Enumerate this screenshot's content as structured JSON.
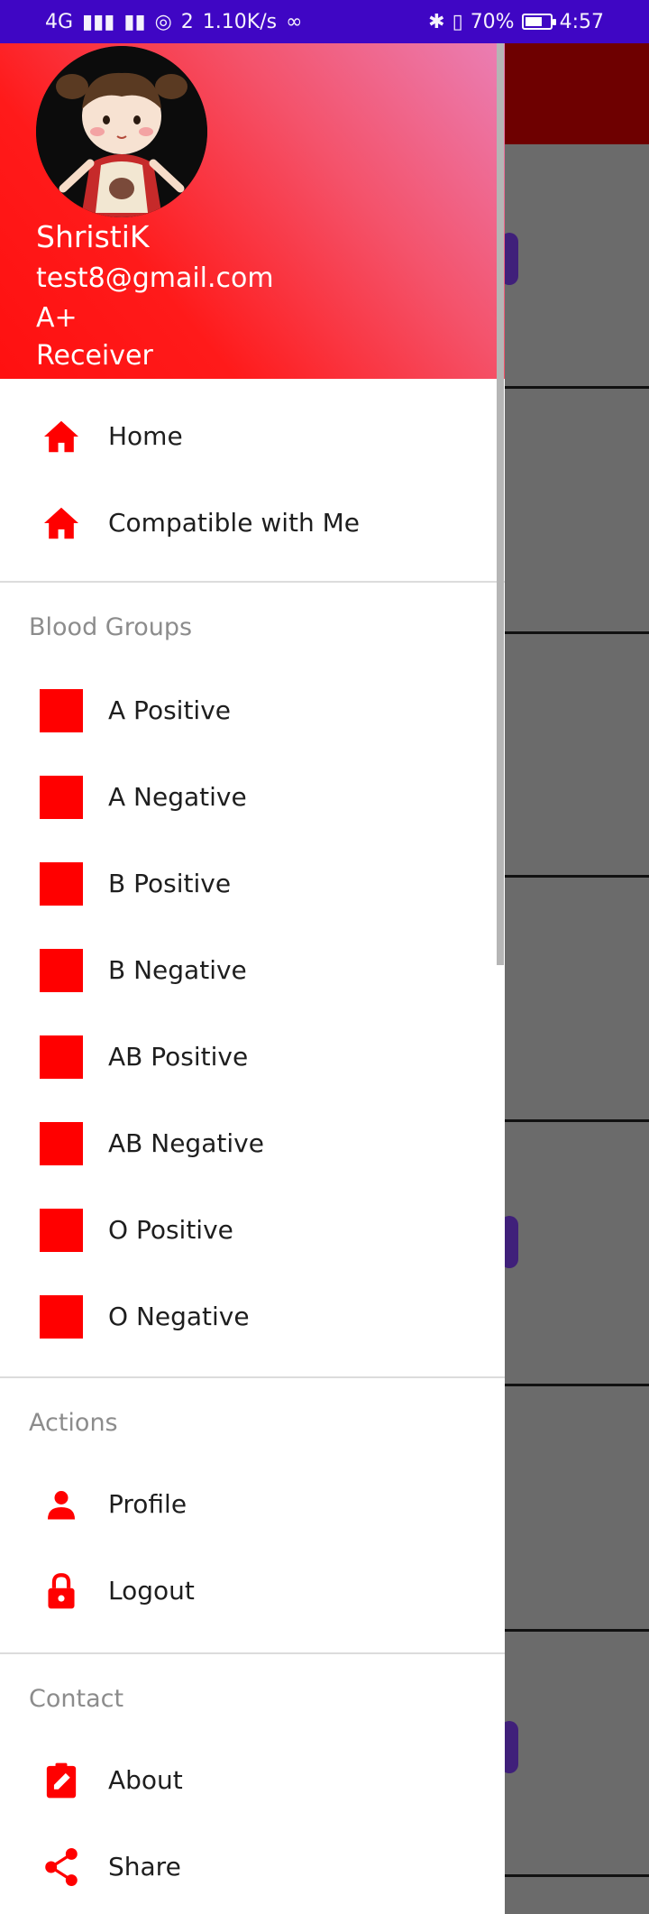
{
  "status_bar": {
    "network": "4G",
    "network2": "2",
    "speed": "1.10K/s",
    "battery_text": "70%",
    "battery_level": 0.7,
    "time": "4:57"
  },
  "header": {
    "name": "ShristiK",
    "email": "test8@gmail.com",
    "blood_group": "A+",
    "role": "Receiver",
    "gradient_from": "#ff0000",
    "gradient_to": "#ea80b8"
  },
  "menu": {
    "primary": [
      {
        "label": "Home",
        "icon": "home-icon"
      },
      {
        "label": "Compatible with Me",
        "icon": "home-icon"
      }
    ],
    "blood_groups_title": "Blood Groups",
    "blood_groups": [
      {
        "label": "A Positive",
        "icon": "red-square-icon"
      },
      {
        "label": "A Negative",
        "icon": "red-square-icon"
      },
      {
        "label": "B Positive",
        "icon": "red-square-icon"
      },
      {
        "label": "B Negative",
        "icon": "red-square-icon"
      },
      {
        "label": "AB Positive",
        "icon": "red-square-icon"
      },
      {
        "label": "AB Negative",
        "icon": "red-square-icon"
      },
      {
        "label": "O Positive",
        "icon": "red-square-icon"
      },
      {
        "label": "O Negative",
        "icon": "red-square-icon"
      }
    ],
    "actions_title": "Actions",
    "actions": [
      {
        "label": "Profile",
        "icon": "person-icon"
      },
      {
        "label": "Logout",
        "icon": "lock-icon"
      }
    ],
    "contact_title": "Contact",
    "contact": [
      {
        "label": "About",
        "icon": "clipboard-edit-icon"
      },
      {
        "label": "Share",
        "icon": "share-icon"
      }
    ]
  },
  "colors": {
    "accent": "#ff0000",
    "status_bar": "#3f06c4"
  }
}
